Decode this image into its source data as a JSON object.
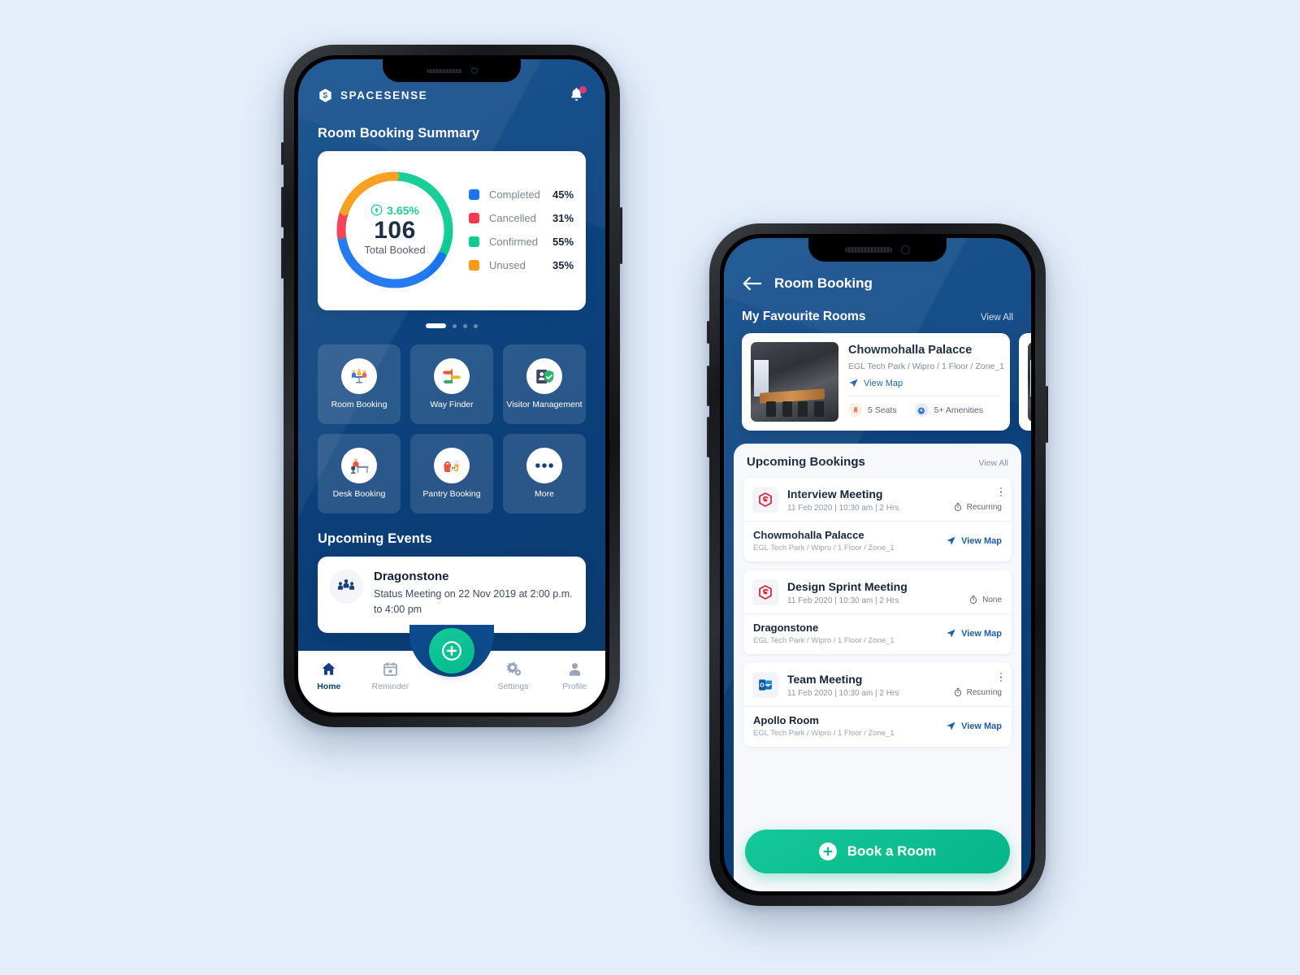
{
  "canvas": {
    "background": "#e4eefb"
  },
  "phone1": {
    "header": {
      "brand": "SPACESENSE",
      "brand_icon": "spacesense-logo-icon",
      "bell_icon": "notification-bell-icon"
    },
    "summary": {
      "title": "Room Booking Summary",
      "delta": "3.65%",
      "delta_icon": "arrow-up-circle-icon",
      "total": "106",
      "total_label": "Total Booked",
      "legend": [
        {
          "label": "Completed",
          "value": "45%",
          "color": "#1a73ef"
        },
        {
          "label": "Cancelled",
          "value": "31%",
          "color": "#f5384e"
        },
        {
          "label": "Confirmed",
          "value": "55%",
          "color": "#0ccb93"
        },
        {
          "label": "Unused",
          "value": "35%",
          "color": "#fa9c17"
        }
      ],
      "pager": {
        "total": 4,
        "active": 0
      }
    },
    "tiles": [
      {
        "label": "Room Booking",
        "icon": "meeting-room-icon",
        "glyph": "👥"
      },
      {
        "label": "Way Finder",
        "icon": "signpost-icon",
        "glyph": "🧭"
      },
      {
        "label": "Visitor Management",
        "icon": "visitor-badge-icon",
        "glyph": "🎫"
      },
      {
        "label": "Desk Booking",
        "icon": "desk-worker-icon",
        "glyph": "💺"
      },
      {
        "label": "Pantry Booking",
        "icon": "pantry-food-icon",
        "glyph": "🍱"
      },
      {
        "label": "More",
        "icon": "more-horizontal-icon",
        "glyph": ""
      }
    ],
    "events": {
      "title": "Upcoming Events",
      "item": {
        "icon": "group-people-icon",
        "name": "Dragonstone",
        "detail": "Status Meeting on 22 Nov 2019 at 2:00 p.m. to 4:00 pm"
      },
      "pager": {
        "total": 4,
        "active": 0
      }
    },
    "nav": {
      "fab_icon": "plus-circle-icon",
      "items": [
        {
          "label": "Home",
          "icon": "home-icon",
          "active": true
        },
        {
          "label": "Reminder",
          "icon": "calendar-icon",
          "active": false
        },
        {
          "label": "Settings",
          "icon": "gear-icon",
          "active": false
        },
        {
          "label": "Profile",
          "icon": "person-icon",
          "active": false
        }
      ]
    }
  },
  "phone2": {
    "header": {
      "back_icon": "arrow-left-icon",
      "title": "Room Booking"
    },
    "favourites": {
      "title": "My Favourite Rooms",
      "view_all": "View All",
      "card": {
        "name": "Chowmohalla Palacce",
        "location": "EGL Tech Park  / Wipro / 1 Floor / Zone_1",
        "map_label": "View Map",
        "map_icon": "navigation-arrow-icon",
        "seats": "5 Seats",
        "seats_icon": "chair-icon",
        "amenities": "5+ Amenities",
        "amenities_icon": "amenities-icon",
        "image_icon": "meeting-room-photo"
      }
    },
    "bookings": {
      "title": "Upcoming Bookings",
      "view_all": "View All",
      "items": [
        {
          "icon": "spacesense-logo-icon",
          "title": "Interview Meeting",
          "meta": "11 Feb 2020  |  10:30 am  |  2 Hrs",
          "recurrence": "Recurring",
          "recurrence_icon": "stopwatch-icon",
          "menu_icon": "kebab-menu-icon",
          "room": "Chowmohalla Palacce",
          "room_location": "EGL Tech Park  / Wipro / 1 Floor / Zone_1",
          "map_label": "View Map",
          "map_icon": "navigation-arrow-icon"
        },
        {
          "icon": "spacesense-logo-icon",
          "title": "Design Sprint Meeting",
          "meta": "11 Feb 2020  |  10:30 am  |  2 Hrs",
          "recurrence": "None",
          "recurrence_icon": "stopwatch-icon",
          "menu_icon": "kebab-menu-icon",
          "room": "Dragonstone",
          "room_location": "EGL Tech Park  / Wipro / 1 Floor / Zone_1",
          "map_label": "View Map",
          "map_icon": "navigation-arrow-icon"
        },
        {
          "icon": "outlook-icon",
          "title": "Team Meeting",
          "meta": "11 Feb 2020  |  10:30 am  |  2 Hrs",
          "recurrence": "Recurring",
          "recurrence_icon": "stopwatch-icon",
          "menu_icon": "kebab-menu-icon",
          "room": "Apollo Room",
          "room_location": "EGL Tech Park  / Wipro / 1 Floor / Zone_1",
          "map_label": "View Map",
          "map_icon": "navigation-arrow-icon"
        }
      ]
    },
    "cta": {
      "label": "Book a Room",
      "icon": "plus-circle-icon"
    }
  },
  "chart_data": {
    "type": "pie",
    "title": "Room Booking Summary",
    "center_value": "106",
    "center_label": "Total Booked",
    "center_delta": "3.65%",
    "categories": [
      "Confirmed",
      "Completed",
      "Cancelled",
      "Unused"
    ],
    "values": [
      55,
      45,
      31,
      35
    ],
    "colors": [
      "#0ccb93",
      "#1a73ef",
      "#f5384e",
      "#fa9c17"
    ],
    "arc_fractions": [
      0.33,
      0.4,
      0.07,
      0.2
    ],
    "legend_position": "right",
    "donut": true
  }
}
